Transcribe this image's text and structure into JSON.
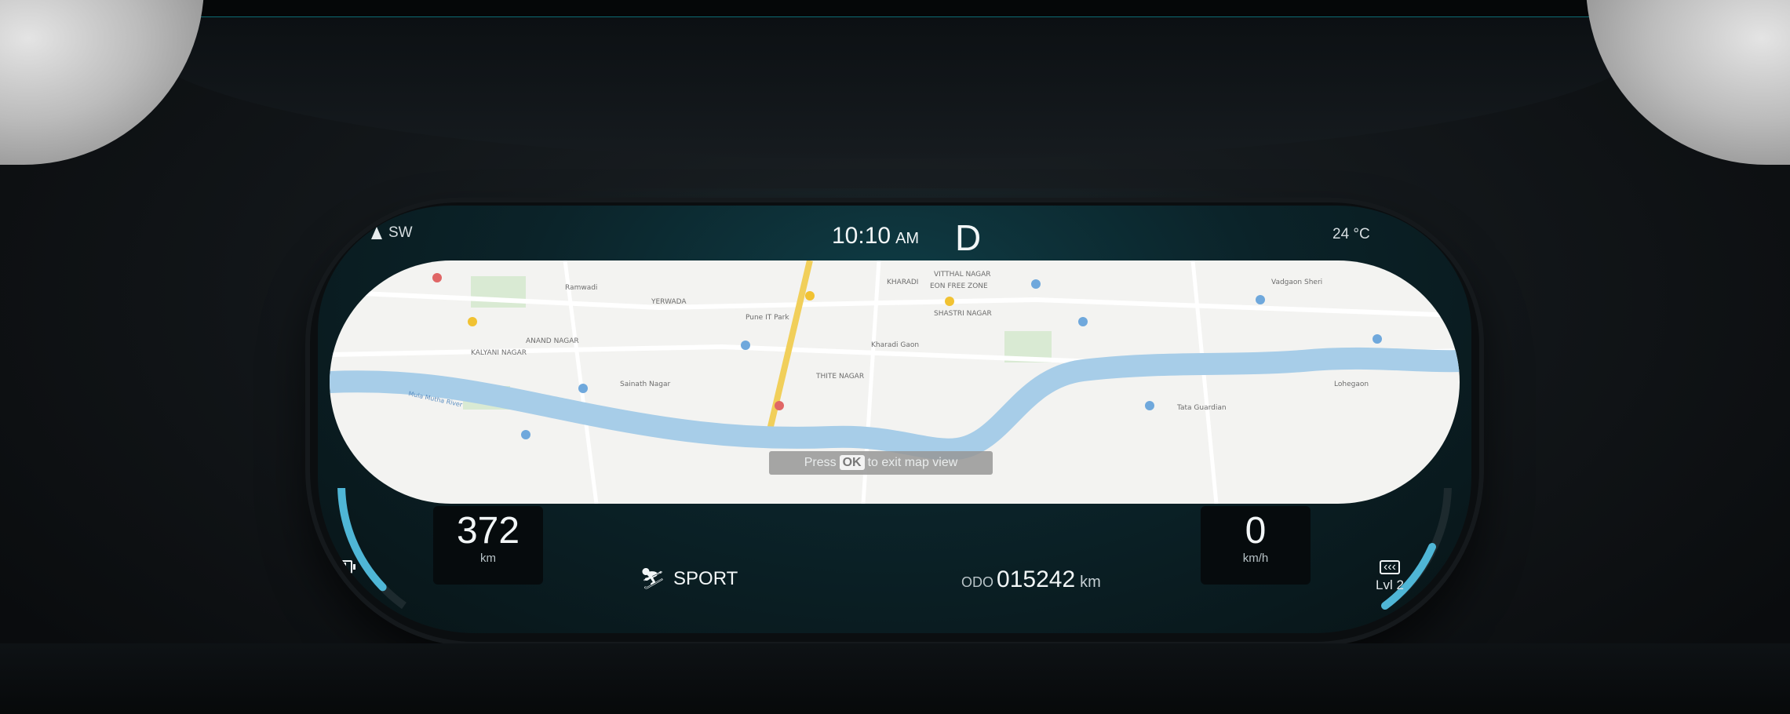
{
  "status": {
    "heading": "SW",
    "time": "10:10",
    "ampm": "AM",
    "gear": "D",
    "temperature": "24 °C"
  },
  "left_gauge": {
    "range_value": "372",
    "range_unit": "km",
    "battery_percent": "80%",
    "battery_level": 0.8
  },
  "right_gauge": {
    "speed_value": "0",
    "speed_unit": "km/h",
    "regen_icon": "regen-icon",
    "regen_level": "Lvl 2"
  },
  "drive": {
    "mode_icon": "sport-mode-icon",
    "mode": "SPORT"
  },
  "odometer": {
    "label": "ODO",
    "value": "015242",
    "unit": "km"
  },
  "map": {
    "hint_pre": "Press",
    "hint_key": "OK",
    "hint_post": "to exit map view",
    "labels": [
      "KALYANI NAGAR",
      "ANAND NAGAR",
      "YERWADA",
      "SHASTRI NAGAR",
      "KHARADI",
      "THITE NAGAR",
      "VITTHAL NAGAR",
      "EON FREE ZONE",
      "Mula Mutha River",
      "Lohegaon",
      "Kharadi Gaon",
      "Tata Guardian",
      "Pune IT Park",
      "Vadgaon Sheri",
      "Ramwadi",
      "Sainath Nagar"
    ]
  },
  "colors": {
    "accent": "#4fb6d6",
    "river": "#a7cde8",
    "road": "#f1cf5a",
    "map_bg": "#f3f3f1"
  }
}
